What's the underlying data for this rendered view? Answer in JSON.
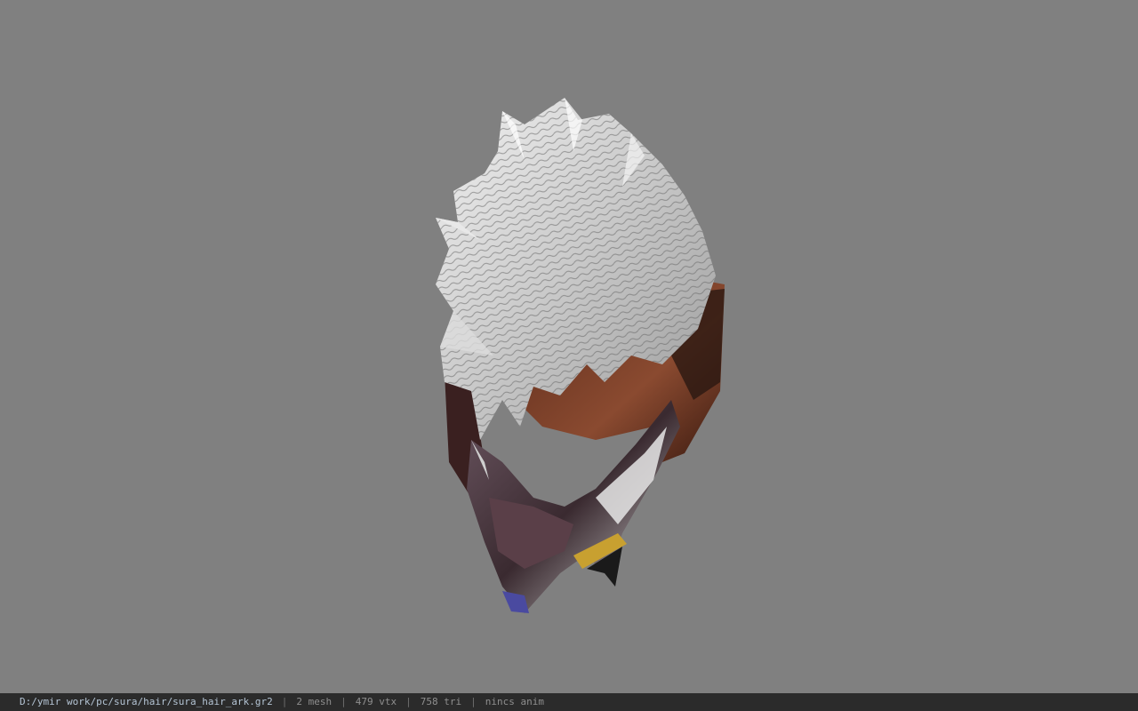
{
  "viewport": {
    "background": "#808080",
    "model_icon": "hair-mesh-render"
  },
  "statusbar": {
    "file_path": "D:/ymir work/pc/sura/hair/sura_hair_ark.gr2",
    "separator": "|",
    "mesh_count": "2 mesh",
    "vertex_count": "479 vtx",
    "triangle_count": "758 tri",
    "animation": "nincs anim"
  }
}
